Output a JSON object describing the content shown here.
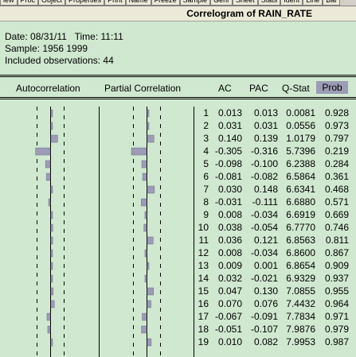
{
  "toolbar": {
    "buttons": [
      "iew",
      "Proc",
      "Object",
      "Properties",
      "Print",
      "Name",
      "Freeze",
      "Sample",
      "Genr",
      "Sheet",
      "Stats",
      "Ident",
      "Line",
      "Bar"
    ]
  },
  "window": {
    "title": "Correlogram of RAIN_RATE"
  },
  "meta": {
    "date_line": "Date: 08/31/11   Time: 11:11",
    "sample_line": "Sample: 1956 1999",
    "obs_line": "Included observations: 44"
  },
  "headers": {
    "autocorrelation": "Autocorrelation",
    "partial_correlation": "Partial Correlation",
    "ac": "AC",
    "pac": "PAC",
    "qstat": "Q-Stat",
    "prob": "Prob"
  },
  "rows": [
    {
      "lag": "1",
      "ac": "0.013",
      "pac": "0.013",
      "q": "0.0081",
      "prob": "0.928"
    },
    {
      "lag": "2",
      "ac": "0.031",
      "pac": "0.031",
      "q": "0.0556",
      "prob": "0.973"
    },
    {
      "lag": "3",
      "ac": "0.140",
      "pac": "0.139",
      "q": "1.0179",
      "prob": "0.797"
    },
    {
      "lag": "4",
      "ac": "-0.305",
      "pac": "-0.316",
      "q": "5.7396",
      "prob": "0.219"
    },
    {
      "lag": "5",
      "ac": "-0.098",
      "pac": "-0.100",
      "q": "6.2388",
      "prob": "0.284"
    },
    {
      "lag": "6",
      "ac": "-0.081",
      "pac": "-0.082",
      "q": "6.5864",
      "prob": "0.361"
    },
    {
      "lag": "7",
      "ac": "0.030",
      "pac": "0.148",
      "q": "6.6341",
      "prob": "0.468"
    },
    {
      "lag": "8",
      "ac": "-0.031",
      "pac": "-0.111",
      "q": "6.6880",
      "prob": "0.571"
    },
    {
      "lag": "9",
      "ac": "0.008",
      "pac": "-0.034",
      "q": "6.6919",
      "prob": "0.669"
    },
    {
      "lag": "10",
      "ac": "0.038",
      "pac": "-0.054",
      "q": "6.7770",
      "prob": "0.746"
    },
    {
      "lag": "11",
      "ac": "0.036",
      "pac": "0.121",
      "q": "6.8563",
      "prob": "0.811"
    },
    {
      "lag": "12",
      "ac": "0.008",
      "pac": "-0.034",
      "q": "6.8600",
      "prob": "0.867"
    },
    {
      "lag": "13",
      "ac": "0.009",
      "pac": "0.001",
      "q": "6.8654",
      "prob": "0.909"
    },
    {
      "lag": "14",
      "ac": "0.032",
      "pac": "-0.021",
      "q": "6.9329",
      "prob": "0.937"
    },
    {
      "lag": "15",
      "ac": "0.047",
      "pac": "0.130",
      "q": "7.0855",
      "prob": "0.955"
    },
    {
      "lag": "16",
      "ac": "0.070",
      "pac": "0.076",
      "q": "7.4432",
      "prob": "0.964"
    },
    {
      "lag": "17",
      "ac": "-0.067",
      "pac": "-0.091",
      "q": "7.7834",
      "prob": "0.971"
    },
    {
      "lag": "18",
      "ac": "-0.051",
      "pac": "-0.107",
      "q": "7.9876",
      "prob": "0.979"
    },
    {
      "lag": "19",
      "ac": "0.010",
      "pac": "0.082",
      "q": "7.9953",
      "prob": "0.987"
    }
  ],
  "colors": {
    "background": "#cfe8cf",
    "bar_fill": "#9c9cb6",
    "prob_header": "#9c9cb6"
  }
}
